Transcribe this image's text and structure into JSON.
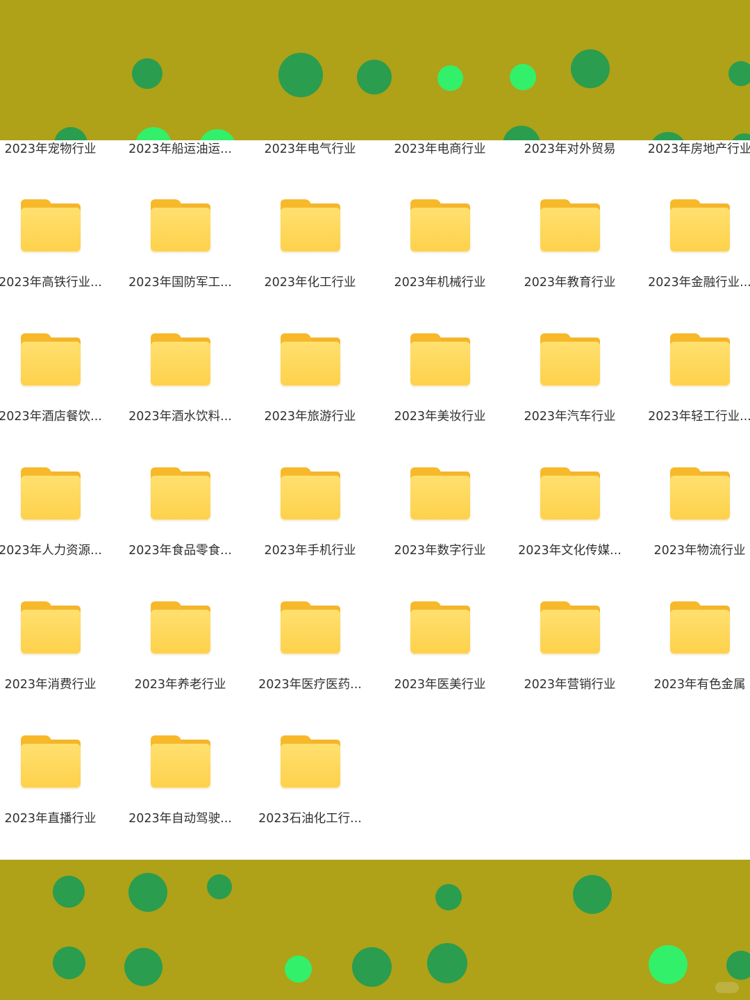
{
  "top_row_labels": [
    "2023年宠物行业",
    "2023年船运油运...",
    "2023年电气行业",
    "2023年电商行业",
    "2023年对外贸易",
    "2023年房地产行业"
  ],
  "folder_rows": [
    [
      "2023年高铁行业...",
      "2023年国防军工...",
      "2023年化工行业",
      "2023年机械行业",
      "2023年教育行业",
      "2023年金融行业..."
    ],
    [
      "2023年酒店餐饮...",
      "2023年酒水饮料...",
      "2023年旅游行业",
      "2023年美妆行业",
      "2023年汽车行业",
      "2023年轻工行业..."
    ],
    [
      "2023年人力资源...",
      "2023年食品零食...",
      "2023年手机行业",
      "2023年数字行业",
      "2023年文化传媒...",
      "2023年物流行业"
    ],
    [
      "2023年消费行业",
      "2023年养老行业",
      "2023年医疗医药...",
      "2023年医美行业",
      "2023年营销行业",
      "2023年有色金属"
    ],
    [
      "2023年直播行业",
      "2023年自动驾驶...",
      "2023石油化工行..."
    ]
  ],
  "icon": "folder-icon",
  "colors": {
    "band": "#afa118",
    "dot_dark": "#2a9d4f",
    "dot_bright": "#33f06a",
    "folder": "#fed14b"
  }
}
